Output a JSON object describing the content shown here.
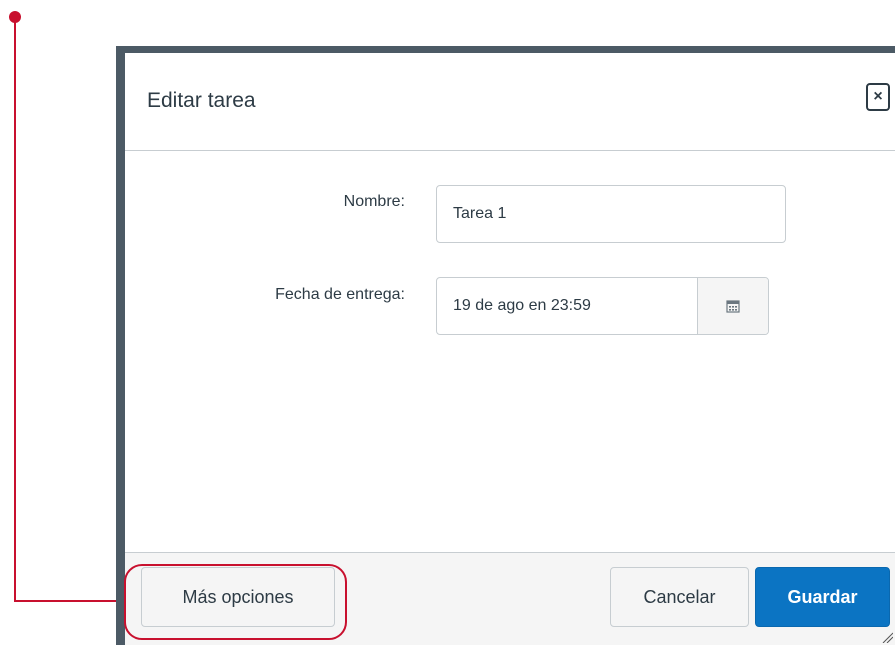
{
  "dialog": {
    "title": "Editar tarea",
    "close_icon": "close-icon",
    "close_glyph": "×"
  },
  "form": {
    "name_label": "Nombre:",
    "name_value": "Tarea 1",
    "due_label": "Fecha de entrega:",
    "due_value": "19 de ago en 23:59",
    "calendar_icon": "calendar-icon"
  },
  "footer": {
    "more_label": "Más opciones",
    "cancel_label": "Cancelar",
    "save_label": "Guardar"
  },
  "colors": {
    "accent": "#0b74c3",
    "callout": "#c8102e",
    "frame": "#4c5a65"
  }
}
